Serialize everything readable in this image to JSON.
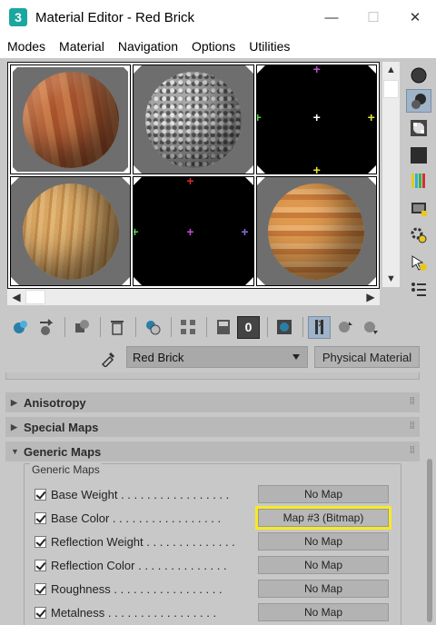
{
  "window": {
    "app_icon_text": "3",
    "title": "Material Editor - Red Brick",
    "minimize_glyph": "—",
    "maximize_glyph": "☐",
    "close_glyph": "✕"
  },
  "menu": [
    "Modes",
    "Material",
    "Navigation",
    "Options",
    "Utilities"
  ],
  "sample_slots": [
    {
      "kind": "sphere",
      "material": "orange-wood",
      "active": true
    },
    {
      "kind": "sphere",
      "material": "gray-gravel",
      "active": false
    },
    {
      "kind": "empty",
      "material": "none",
      "active": false
    },
    {
      "kind": "sphere",
      "material": "light-wood",
      "active": false
    },
    {
      "kind": "empty",
      "material": "none",
      "active": false
    },
    {
      "kind": "sphere",
      "material": "striped-wood",
      "active": false
    }
  ],
  "side_toolbar": {
    "icons": [
      "sample-type-icon",
      "backlight-icon",
      "background-icon",
      "tiling-icon",
      "video-color-check-icon",
      "make-preview-icon",
      "options-icon",
      "select-by-material-icon",
      "material-map-navigator-icon"
    ],
    "active_index": 1
  },
  "main_toolbar": {
    "icons": [
      "get-material-icon",
      "put-to-scene-icon",
      "assign-to-selection-icon",
      "reset-map-icon",
      "make-unique-icon",
      "put-to-library-icon",
      "material-id-channel-icon",
      "show-shaded-in-viewport-icon",
      "show-end-result-icon",
      "go-to-parent-icon",
      "go-forward-to-sibling-icon"
    ],
    "material_id": "0"
  },
  "material_name": "Red Brick",
  "material_type": "Physical Material",
  "rollouts": [
    {
      "title": "Anisotropy",
      "expanded": false
    },
    {
      "title": "Special Maps",
      "expanded": false
    },
    {
      "title": "Generic Maps",
      "expanded": true
    }
  ],
  "generic_maps": {
    "group_label": "Generic Maps",
    "rows": [
      {
        "label": "Base Weight . . . . . . . . . . . . . . . . .",
        "checked": true,
        "map": "No Map",
        "highlight": false
      },
      {
        "label": "Base Color . . . . . . . . . . . . . . . . .",
        "checked": true,
        "map": "Map #3 (Bitmap)",
        "highlight": true
      },
      {
        "label": "Reflection Weight . . . . . . . . . . . . . .",
        "checked": true,
        "map": "No Map",
        "highlight": false
      },
      {
        "label": "Reflection Color . . . . . . . . . . . . . .",
        "checked": true,
        "map": "No Map",
        "highlight": false
      },
      {
        "label": "Roughness . . . . . . . . . . . . . . . . .",
        "checked": true,
        "map": "No Map",
        "highlight": false
      },
      {
        "label": "Metalness . . . . . . . . . . . . . . . . .",
        "checked": true,
        "map": "No Map",
        "highlight": false
      }
    ]
  },
  "colors": {
    "highlight": "#f6ea24",
    "active_button": "#9fb3c9",
    "panel_bg": "#c8c8c8"
  }
}
